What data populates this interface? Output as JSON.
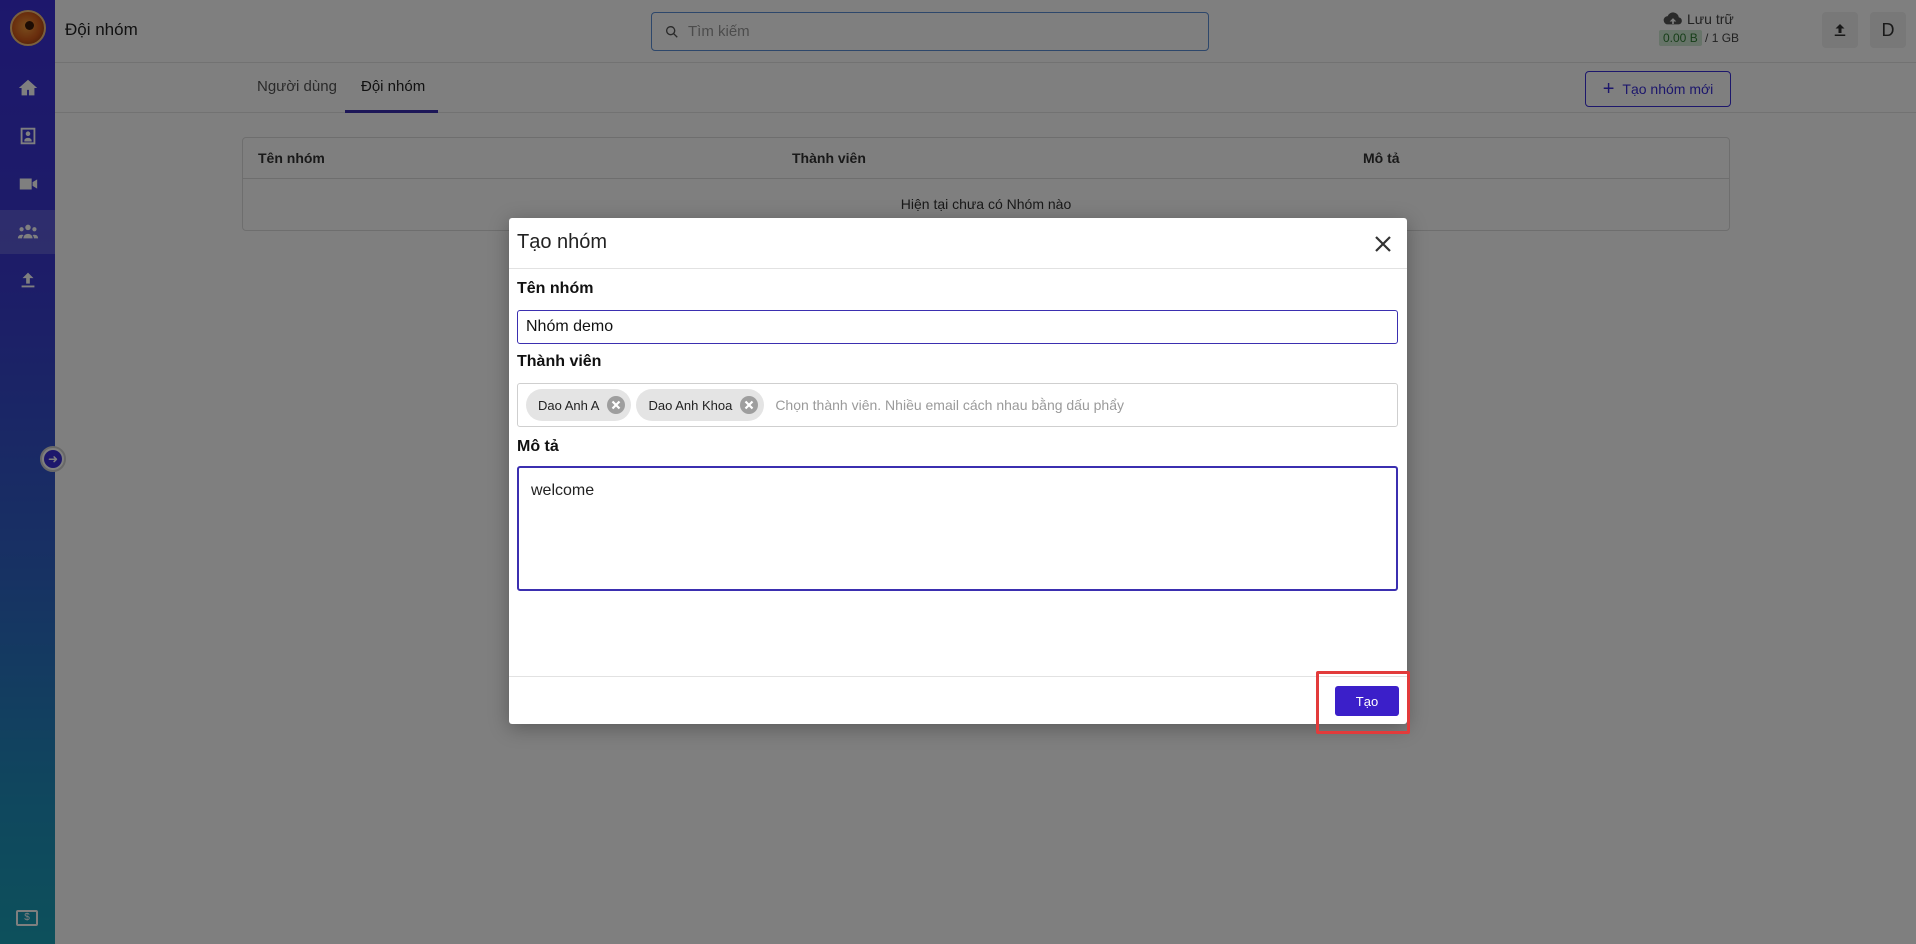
{
  "header": {
    "page_title": "Đội nhóm",
    "search_placeholder": "Tìm kiếm",
    "storage_label": "Lưu trữ",
    "storage_used": "0.00 B",
    "storage_total": "/ 1 GB",
    "avatar_initial": "D"
  },
  "sidebar": {
    "items": [
      {
        "icon": "home-icon"
      },
      {
        "icon": "contacts-icon"
      },
      {
        "icon": "video-icon"
      },
      {
        "icon": "group-icon",
        "active": true
      },
      {
        "icon": "upload-icon"
      }
    ]
  },
  "tabs": {
    "users": "Người dùng",
    "teams": "Đội nhóm",
    "new_group_button": "Tạo nhóm mới"
  },
  "table": {
    "columns": [
      "Tên nhóm",
      "Thành viên",
      "Mô tả"
    ],
    "empty_message": "Hiện tại chưa có Nhóm nào"
  },
  "modal": {
    "title": "Tạo nhóm",
    "name_label": "Tên nhóm",
    "name_value": "Nhóm demo",
    "members_label": "Thành viên",
    "members": [
      "Dao Anh A",
      "Dao Anh Khoa"
    ],
    "members_placeholder": "Chọn thành viên. Nhiều email cách nhau bằng dấu phẩy",
    "description_label": "Mô tả",
    "description_value": "welcome",
    "create_button": "Tạo"
  },
  "colors": {
    "accent": "#3b2fd9",
    "primary_button": "#3b1fc9",
    "highlight": "#e23b3b"
  }
}
